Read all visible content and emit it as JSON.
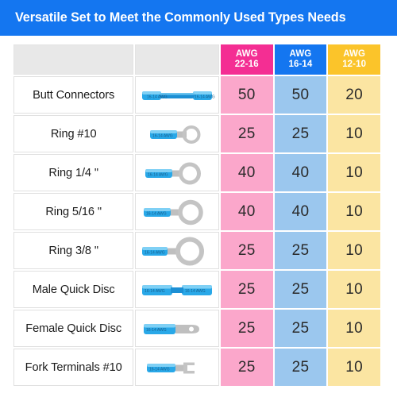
{
  "banner": {
    "title": "Versatile Set to Meet the Commonly Used Types Needs",
    "background_color": "#1476F0",
    "text_color": "#FFFFFF"
  },
  "table": {
    "header": {
      "blank_label_1": "",
      "blank_label_2": "",
      "columns": [
        {
          "line1": "AWG",
          "line2": "22-16",
          "header_color": "#F42E93",
          "cell_color": "#FBA7CB"
        },
        {
          "line1": "AWG",
          "line2": "16-14",
          "header_color": "#1476F0",
          "cell_color": "#9BC7EE"
        },
        {
          "line1": "AWG",
          "line2": "12-10",
          "header_color": "#FBC42A",
          "cell_color": "#FBE5A2"
        }
      ]
    },
    "rows": [
      {
        "name": "Butt Connectors",
        "icon": "butt-connector-icon",
        "awg_22_16": "50",
        "awg_16_14": "50",
        "awg_12_10": "20"
      },
      {
        "name": "Ring #10",
        "icon": "ring-terminal-small-icon",
        "awg_22_16": "25",
        "awg_16_14": "25",
        "awg_12_10": "10"
      },
      {
        "name": "Ring 1/4 \"",
        "icon": "ring-terminal-quarter-icon",
        "awg_22_16": "40",
        "awg_16_14": "40",
        "awg_12_10": "10"
      },
      {
        "name": "Ring 5/16 \"",
        "icon": "ring-terminal-516-icon",
        "awg_22_16": "40",
        "awg_16_14": "40",
        "awg_12_10": "10"
      },
      {
        "name": "Ring 3/8 \"",
        "icon": "ring-terminal-38-icon",
        "awg_22_16": "25",
        "awg_16_14": "25",
        "awg_12_10": "10"
      },
      {
        "name": "Male Quick Disc",
        "icon": "male-quick-disconnect-icon",
        "awg_22_16": "25",
        "awg_16_14": "25",
        "awg_12_10": "10"
      },
      {
        "name": "Female Quick Disc",
        "icon": "female-quick-disconnect-icon",
        "awg_22_16": "25",
        "awg_16_14": "25",
        "awg_12_10": "10"
      },
      {
        "name": "Fork Terminals #10",
        "icon": "fork-terminal-icon",
        "awg_22_16": "25",
        "awg_16_14": "25",
        "awg_12_10": "10"
      }
    ]
  }
}
